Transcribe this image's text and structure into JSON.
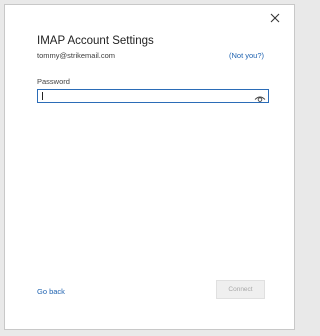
{
  "dialog": {
    "title": "IMAP Account Settings",
    "email": "tommy@strikemail.com",
    "not_you_link": "(Not you?)",
    "password_label": "Password",
    "password_value": "",
    "go_back_link": "Go back",
    "connect_button": "Connect",
    "connect_enabled": false
  },
  "icons": {
    "close": "close-icon",
    "reveal_password": "eye-icon"
  },
  "colors": {
    "link": "#1e62b0",
    "field_border": "#2b6cb7",
    "disabled_button_bg": "#efefef",
    "disabled_button_text": "#a8a8a8"
  }
}
